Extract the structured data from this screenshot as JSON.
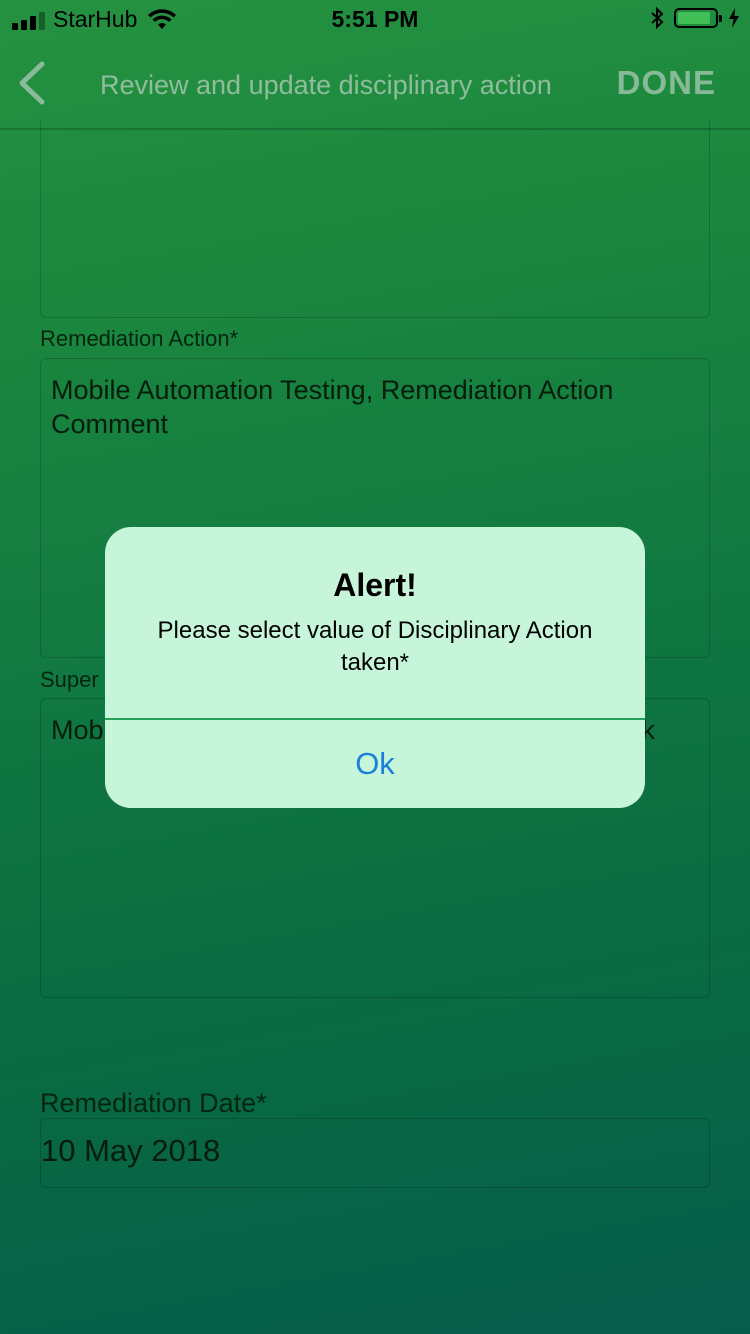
{
  "status_bar": {
    "carrier": "StarHub",
    "time": "5:51 PM"
  },
  "nav": {
    "title": "Review and update disciplinary action",
    "done_label": "DONE"
  },
  "form": {
    "remediation_action": {
      "label": "Remediation Action*",
      "value": "Mobile Automation Testing, Remediation Action Comment"
    },
    "supervisor": {
      "label_visible": "Super",
      "value_visible_start": "Mob",
      "value_visible_end": "k"
    },
    "remediation_date": {
      "label": "Remediation Date*",
      "value": "10 May 2018"
    }
  },
  "alert": {
    "title": "Alert!",
    "message": "Please select value of Disciplinary Action taken*",
    "ok_label": "Ok"
  },
  "colors": {
    "background_top": "#2aa64a",
    "background_bottom": "#086a56",
    "alert_background": "#c6f5d9",
    "alert_button": "#1a7fdb"
  },
  "icons": [
    "signal-icon",
    "wifi-icon",
    "bluetooth-icon",
    "battery-icon",
    "charging-icon",
    "back-chevron-icon"
  ]
}
